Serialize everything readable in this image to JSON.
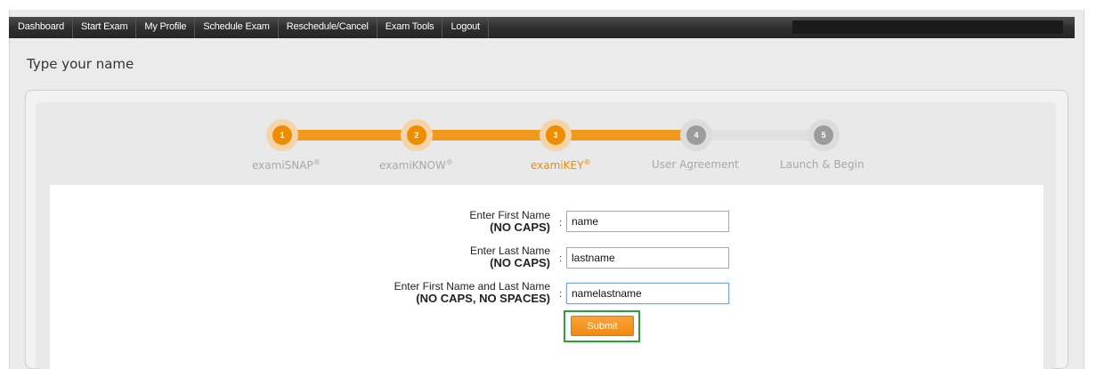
{
  "nav": {
    "items": [
      "Dashboard",
      "Start Exam",
      "My Profile",
      "Schedule Exam",
      "Reschedule/Cancel",
      "Exam Tools",
      "Logout"
    ]
  },
  "page": {
    "title": "Type your name"
  },
  "steps": [
    {
      "number": "1",
      "label": "examiSNAP",
      "mark": "®",
      "state": "done"
    },
    {
      "number": "2",
      "label": "examiKNOW",
      "mark": "®",
      "state": "done"
    },
    {
      "number": "3",
      "label": "examiKEY",
      "mark": "®",
      "state": "active"
    },
    {
      "number": "4",
      "label": "User Agreement",
      "mark": "",
      "state": "todo"
    },
    {
      "number": "5",
      "label": "Launch & Begin",
      "mark": "",
      "state": "todo"
    }
  ],
  "form": {
    "first_name": {
      "label": "Enter First Name",
      "hint": "(NO CAPS)",
      "value": "name"
    },
    "last_name": {
      "label": "Enter Last Name",
      "hint": "(NO CAPS)",
      "value": "lastname"
    },
    "full_name": {
      "label": "Enter First Name and Last Name",
      "hint": "(NO CAPS, NO SPACES)",
      "value": "namelastname"
    },
    "colon": ":",
    "submit_label": "Submit"
  },
  "colors": {
    "accent": "#f08c00",
    "highlight": "#27a637",
    "navbar": "#333333"
  }
}
